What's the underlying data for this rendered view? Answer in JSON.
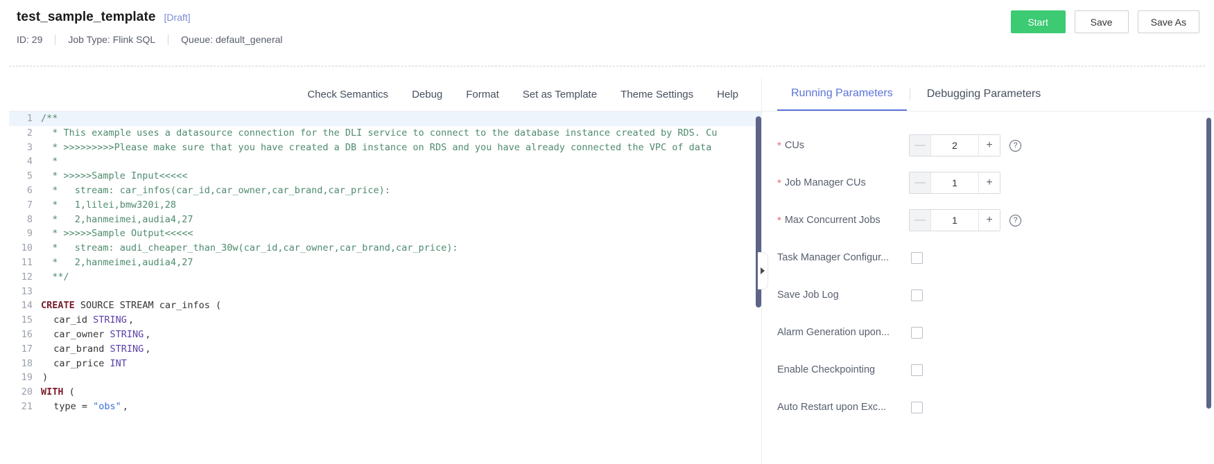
{
  "header": {
    "job_title": "test_sample_template",
    "draft_tag": "[Draft]",
    "meta": [
      "ID: 29",
      "Job Type: Flink SQL",
      "Queue: default_general"
    ],
    "actions": {
      "start": "Start",
      "save": "Save",
      "save_as": "Save As"
    },
    "colors": {
      "start_button": "#3cca72",
      "draft_tag": "#7a8bd0"
    }
  },
  "editor_toolbar": {
    "items": [
      "Check Semantics",
      "Debug",
      "Format",
      "Set as Template",
      "Theme Settings",
      "Help"
    ]
  },
  "editor": {
    "lines": [
      {
        "n": "1",
        "segments": [
          {
            "cls": "cm",
            "t": "/**"
          }
        ],
        "active": true
      },
      {
        "n": "2",
        "segments": [
          {
            "cls": "cm",
            "t": "  * This example uses a datasource connection for the DLI service to connect to the database instance created by RDS. Cu"
          }
        ]
      },
      {
        "n": "3",
        "segments": [
          {
            "cls": "cm",
            "t": "  * >>>>>>>>>Please make sure that you have created a DB instance on RDS and you have already connected the VPC of data"
          }
        ]
      },
      {
        "n": "4",
        "segments": [
          {
            "cls": "cm",
            "t": "  *"
          }
        ]
      },
      {
        "n": "5",
        "segments": [
          {
            "cls": "cm",
            "t": "  * >>>>>Sample Input<<<<<"
          }
        ]
      },
      {
        "n": "6",
        "segments": [
          {
            "cls": "cm",
            "t": "  *   stream: car_infos(car_id,car_owner,car_brand,car_price):"
          }
        ]
      },
      {
        "n": "7",
        "segments": [
          {
            "cls": "cm",
            "t": "  *   1,lilei,bmw320i,28"
          }
        ]
      },
      {
        "n": "8",
        "segments": [
          {
            "cls": "cm",
            "t": "  *   2,hanmeimei,audia4,27"
          }
        ]
      },
      {
        "n": "9",
        "segments": [
          {
            "cls": "cm",
            "t": "  * >>>>>Sample Output<<<<<"
          }
        ]
      },
      {
        "n": "10",
        "segments": [
          {
            "cls": "cm",
            "t": "  *   stream: audi_cheaper_than_30w(car_id,car_owner,car_brand,car_price):"
          }
        ]
      },
      {
        "n": "11",
        "segments": [
          {
            "cls": "cm",
            "t": "  *   2,hanmeimei,audia4,27"
          }
        ]
      },
      {
        "n": "12",
        "segments": [
          {
            "cls": "cm",
            "t": "  **/"
          }
        ]
      },
      {
        "n": "13",
        "segments": [
          {
            "cls": "ctext",
            "t": ""
          }
        ]
      },
      {
        "n": "14",
        "segments": [
          {
            "cls": "kw",
            "t": "CREATE"
          },
          {
            "cls": "kw2",
            "t": " SOURCE STREAM car_infos ("
          }
        ]
      },
      {
        "n": "15",
        "segments": [
          {
            "cls": "ctext",
            "t": "  car_id "
          },
          {
            "cls": "ty",
            "t": "STRING"
          },
          {
            "cls": "ctext",
            "t": ","
          }
        ]
      },
      {
        "n": "16",
        "segments": [
          {
            "cls": "ctext",
            "t": "  car_owner "
          },
          {
            "cls": "ty",
            "t": "STRING"
          },
          {
            "cls": "ctext",
            "t": ","
          }
        ]
      },
      {
        "n": "17",
        "segments": [
          {
            "cls": "ctext",
            "t": "  car_brand "
          },
          {
            "cls": "ty",
            "t": "STRING"
          },
          {
            "cls": "ctext",
            "t": ","
          }
        ]
      },
      {
        "n": "18",
        "segments": [
          {
            "cls": "ctext",
            "t": "  car_price "
          },
          {
            "cls": "ty",
            "t": "INT"
          }
        ]
      },
      {
        "n": "19",
        "segments": [
          {
            "cls": "ctext",
            "t": ")"
          }
        ]
      },
      {
        "n": "20",
        "segments": [
          {
            "cls": "kw",
            "t": "WITH"
          },
          {
            "cls": "kw2",
            "t": " ("
          }
        ]
      },
      {
        "n": "21",
        "segments": [
          {
            "cls": "ctext",
            "t": "  type = "
          },
          {
            "cls": "str",
            "t": "\"obs\""
          },
          {
            "cls": "ctext",
            "t": ","
          }
        ]
      }
    ]
  },
  "params_panel": {
    "tabs": [
      {
        "label": "Running Parameters",
        "active": true
      },
      {
        "label": "Debugging Parameters",
        "active": false
      }
    ],
    "steppers": [
      {
        "label": "CUs",
        "required": true,
        "value": "2",
        "minus": "—",
        "plus": "+",
        "help": "?"
      },
      {
        "label": "Job Manager CUs",
        "required": true,
        "value": "1",
        "minus": "—",
        "plus": "+",
        "help": ""
      },
      {
        "label": "Max Concurrent Jobs",
        "required": true,
        "value": "1",
        "minus": "—",
        "plus": "+",
        "help": "?"
      }
    ],
    "checkboxes": [
      {
        "label": "Task Manager Configur...",
        "checked": false
      },
      {
        "label": "Save Job Log",
        "checked": false
      },
      {
        "label": "Alarm Generation upon...",
        "checked": false
      },
      {
        "label": "Enable Checkpointing",
        "checked": false
      },
      {
        "label": "Auto Restart upon Exc...",
        "checked": false
      }
    ],
    "colors": {
      "active_tab": "#5a74d8",
      "required_star": "#e8686d"
    }
  }
}
